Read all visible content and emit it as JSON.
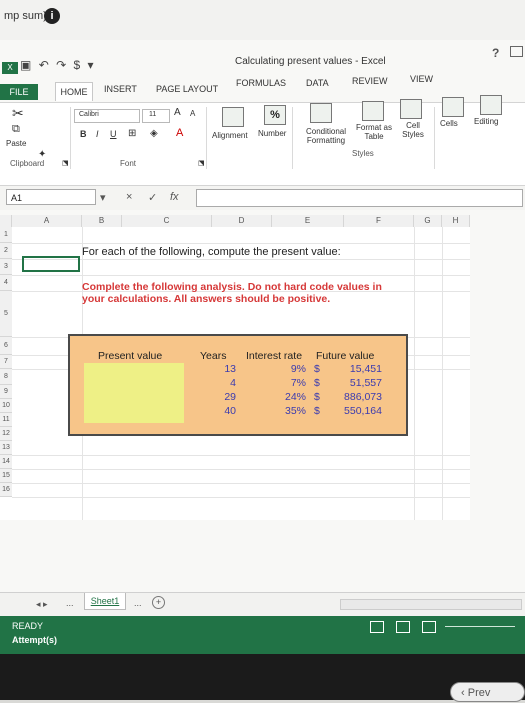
{
  "top_caption": "mp sum)",
  "window": {
    "title": "Calculating present values - Excel",
    "help": "?"
  },
  "tabs": [
    "FILE",
    "HOME",
    "INSERT",
    "PAGE LAYOUT",
    "FORMULAS",
    "DATA",
    "REVIEW",
    "VIEW"
  ],
  "ribbon": {
    "paste": "Paste",
    "font_name": "Calibri",
    "font_size": "11",
    "bold": "B",
    "italic": "I",
    "underline": "U",
    "alignment": "Alignment",
    "number": "Number",
    "percent": "%",
    "conditional_formatting": "Conditional Formatting",
    "format_as_table": "Format as Table",
    "cell_styles": "Cell Styles",
    "cells": "Cells",
    "editing": "Editing",
    "groups": {
      "clipboard": "Clipboard",
      "font": "Font",
      "styles": "Styles"
    }
  },
  "formula_bar": {
    "name_box": "A1",
    "fx": "fx",
    "cancel": "×",
    "enter": "✓",
    "formula": ""
  },
  "columns": [
    "A",
    "B",
    "C",
    "D",
    "E",
    "F",
    "G",
    "H"
  ],
  "rows": [
    "1",
    "2",
    "3",
    "4",
    "5",
    "6",
    "7",
    "8",
    "9",
    "10",
    "11",
    "12",
    "13",
    "14",
    "15",
    "16"
  ],
  "content": {
    "intro": "For each of the following, compute the present value:",
    "instruction": "Complete the following analysis. Do not hard code values in your calculations. All answers should be positive."
  },
  "table": {
    "headers": [
      "Present value",
      "Years",
      "Interest rate",
      "Future value"
    ],
    "rows": [
      {
        "years": "13",
        "rate": "9%",
        "currency": "$",
        "fv": "15,451"
      },
      {
        "years": "4",
        "rate": "7%",
        "currency": "$",
        "fv": "51,557"
      },
      {
        "years": "29",
        "rate": "24%",
        "currency": "$",
        "fv": "886,073"
      },
      {
        "years": "40",
        "rate": "35%",
        "currency": "$",
        "fv": "550,164"
      }
    ]
  },
  "sheet_tabs": {
    "nav": "◂  ▸",
    "more_left": "...",
    "active": "Sheet1",
    "more_right": "...",
    "add": "+"
  },
  "status": {
    "ready": "READY",
    "attempts": "Attempt(s)"
  },
  "prev_button": "Prev",
  "colors": {
    "excel_green": "#217346",
    "table_fill": "#f7c589",
    "input_fill": "#eef086",
    "instruction_red": "#d63838",
    "value_blue": "#3b3baf"
  }
}
